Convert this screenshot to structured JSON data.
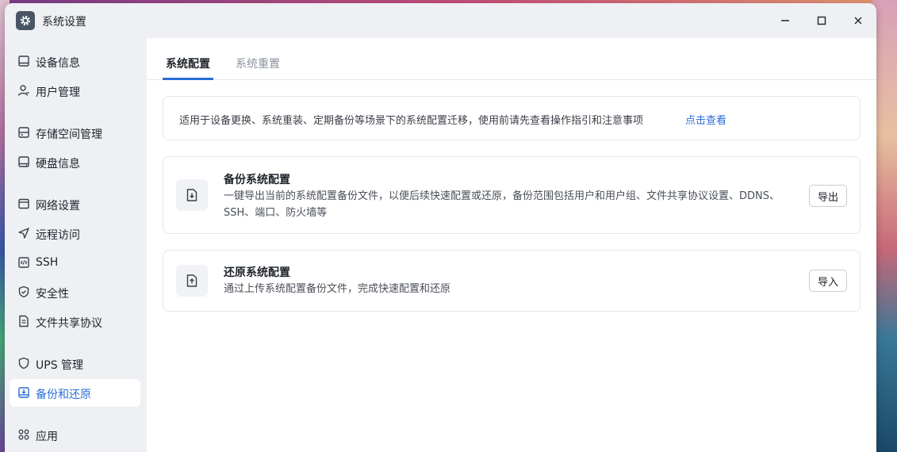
{
  "window": {
    "title": "系统设置",
    "icon": "gear-icon"
  },
  "sidebar": {
    "items": [
      {
        "label": "设备信息",
        "icon": "device-icon"
      },
      {
        "label": "用户管理",
        "icon": "user-icon"
      },
      {
        "label": "存储空间管理",
        "icon": "storage-icon"
      },
      {
        "label": "硬盘信息",
        "icon": "disk-icon"
      },
      {
        "label": "网络设置",
        "icon": "network-icon"
      },
      {
        "label": "远程访问",
        "icon": "send-icon"
      },
      {
        "label": "SSH",
        "icon": "code-icon"
      },
      {
        "label": "安全性",
        "icon": "shield-check-icon"
      },
      {
        "label": "文件共享协议",
        "icon": "document-icon"
      },
      {
        "label": "UPS 管理",
        "icon": "shield-icon"
      },
      {
        "label": "备份和还原",
        "icon": "backup-icon",
        "active": true
      },
      {
        "label": "应用",
        "icon": "apps-icon"
      }
    ]
  },
  "tabs": [
    {
      "label": "系统配置",
      "active": true
    },
    {
      "label": "系统重置",
      "active": false
    }
  ],
  "notice": {
    "text": "适用于设备更换、系统重装、定期备份等场景下的系统配置迁移，使用前请先查看操作指引和注意事项",
    "link": "点击查看"
  },
  "cards": [
    {
      "title": "备份系统配置",
      "description": "一键导出当前的系统配置备份文件，以便后续快速配置或还原，备份范围包括用户和用户组、文件共享协议设置、DDNS、SSH、端口、防火墙等",
      "button": "导出",
      "icon": "download-file-icon"
    },
    {
      "title": "还原系统配置",
      "description": "通过上传系统配置备份文件，完成快速配置和还原",
      "button": "导入",
      "icon": "upload-file-icon"
    }
  ],
  "colors": {
    "accent": "#2a6ed6",
    "sidebar_bg": "#eef0f4"
  }
}
